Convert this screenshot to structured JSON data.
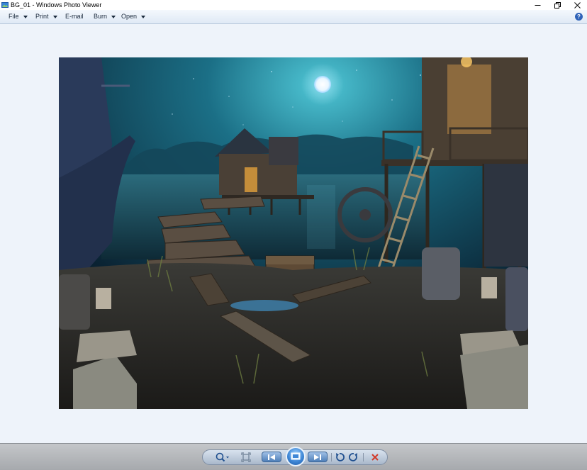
{
  "window": {
    "title": "BG_01 - Windows Photo Viewer",
    "controls": [
      "minimize",
      "restore",
      "close"
    ]
  },
  "menu": {
    "file": "File",
    "print": "Print",
    "email": "E-mail",
    "burn": "Burn",
    "open": "Open",
    "help_glyph": "?"
  },
  "photo": {
    "name": "BG_01",
    "description_icon": "fantasy-night-lake-scene"
  },
  "toolbar": {
    "buttons": [
      "zoom-icon",
      "actual-size-icon",
      "previous-icon",
      "slideshow-icon",
      "next-icon",
      "rotate-counterclockwise-icon",
      "rotate-clockwise-icon",
      "delete-icon"
    ]
  },
  "colors": {
    "accent": "#2f63b8",
    "delete": "#d23a2a",
    "view_background": "#eef3fa"
  }
}
